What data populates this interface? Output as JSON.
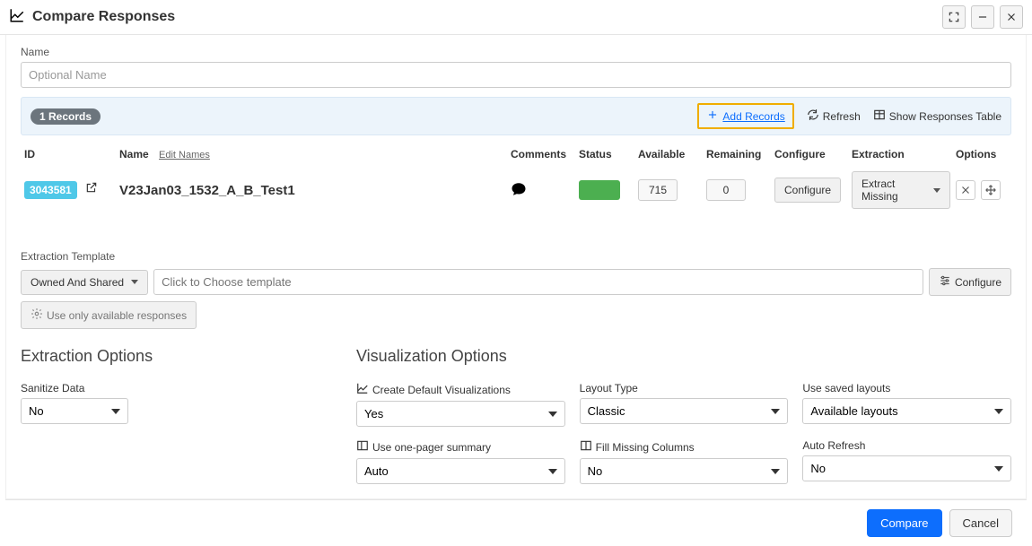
{
  "titlebar": {
    "title": "Compare Responses"
  },
  "nameField": {
    "label": "Name",
    "placeholder": "Optional Name",
    "value": ""
  },
  "recordsBar": {
    "badge": "1 Records",
    "addRecords": "Add Records",
    "refresh": "Refresh",
    "showResponsesTable": "Show Responses Table"
  },
  "recordsTable": {
    "headers": {
      "id": "ID",
      "name": "Name",
      "editNames": "Edit Names",
      "comments": "Comments",
      "status": "Status",
      "available": "Available",
      "remaining": "Remaining",
      "configure": "Configure",
      "extraction": "Extraction",
      "options": "Options"
    },
    "row": {
      "id": "3043581",
      "name": "V23Jan03_1532_A_B_Test1",
      "available": "715",
      "remaining": "0",
      "configure": "Configure",
      "extraction": "Extract Missing"
    }
  },
  "extractionTemplate": {
    "label": "Extraction Template",
    "ownership": "Owned And Shared",
    "placeholder": "Click to Choose template",
    "configure": "Configure",
    "useOnlyAvailable": "Use only available responses"
  },
  "extractionOptions": {
    "title": "Extraction Options",
    "sanitize": {
      "label": "Sanitize Data",
      "value": "No"
    }
  },
  "vizOptions": {
    "title": "Visualization Options",
    "createDefault": {
      "label": "Create Default Visualizations",
      "value": "Yes"
    },
    "layoutType": {
      "label": "Layout Type",
      "value": "Classic"
    },
    "savedLayouts": {
      "label": "Use saved layouts",
      "value": "Available layouts"
    },
    "onePager": {
      "label": "Use one-pager summary",
      "value": "Auto"
    },
    "fillMissing": {
      "label": "Fill Missing Columns",
      "value": "No"
    },
    "autoRefresh": {
      "label": "Auto Refresh",
      "value": "No"
    }
  },
  "footer": {
    "compare": "Compare",
    "cancel": "Cancel"
  }
}
